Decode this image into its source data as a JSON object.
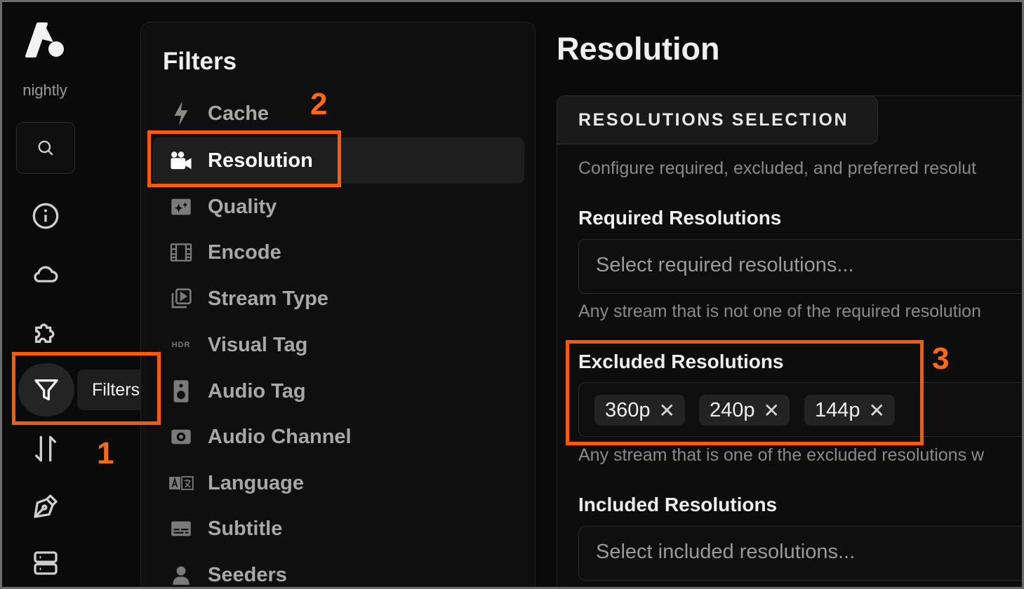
{
  "brand": {
    "name": "nightly"
  },
  "rail": {
    "items": [
      {
        "name": "search",
        "icon": "search-icon"
      },
      {
        "name": "about",
        "icon": "info-icon"
      },
      {
        "name": "services",
        "icon": "cloud-icon"
      },
      {
        "name": "addons",
        "icon": "puzzle-icon"
      },
      {
        "name": "filters",
        "icon": "filter-icon",
        "active": true
      },
      {
        "name": "sorting",
        "icon": "sort-arrows-icon"
      },
      {
        "name": "formatter",
        "icon": "pen-icon"
      },
      {
        "name": "misc",
        "icon": "server-icon"
      }
    ],
    "tooltip": "Filters"
  },
  "panel": {
    "title": "Filters",
    "items": [
      {
        "label": "Cache",
        "icon": "bolt-icon"
      },
      {
        "label": "Resolution",
        "icon": "video-camera-icon",
        "active": true
      },
      {
        "label": "Quality",
        "icon": "sparkle-film-icon"
      },
      {
        "label": "Encode",
        "icon": "film-icon"
      },
      {
        "label": "Stream Type",
        "icon": "play-stack-icon"
      },
      {
        "label": "Visual Tag",
        "icon": "hdr-icon"
      },
      {
        "label": "Audio Tag",
        "icon": "speaker-icon"
      },
      {
        "label": "Audio Channel",
        "icon": "surround-icon"
      },
      {
        "label": "Language",
        "icon": "translate-icon"
      },
      {
        "label": "Subtitle",
        "icon": "subtitles-icon"
      },
      {
        "label": "Seeders",
        "icon": "user-icon"
      }
    ],
    "hdr_text": "HDR"
  },
  "main": {
    "title": "Resolution",
    "section_tab": "RESOLUTIONS SELECTION",
    "section_desc": "Configure required, excluded, and preferred resolut",
    "required": {
      "label": "Required Resolutions",
      "placeholder": "Select required resolutions...",
      "help": "Any stream that is not one of the required resolution"
    },
    "excluded": {
      "label": "Excluded Resolutions",
      "chips": [
        "360p",
        "240p",
        "144p"
      ],
      "chip_remove": "✕",
      "help": "Any stream that is one of the excluded resolutions w"
    },
    "included": {
      "label": "Included Resolutions",
      "placeholder": "Select included resolutions..."
    }
  },
  "annotations": {
    "step1": "1",
    "step2": "2",
    "step3": "3",
    "color": "#ff5a00"
  }
}
